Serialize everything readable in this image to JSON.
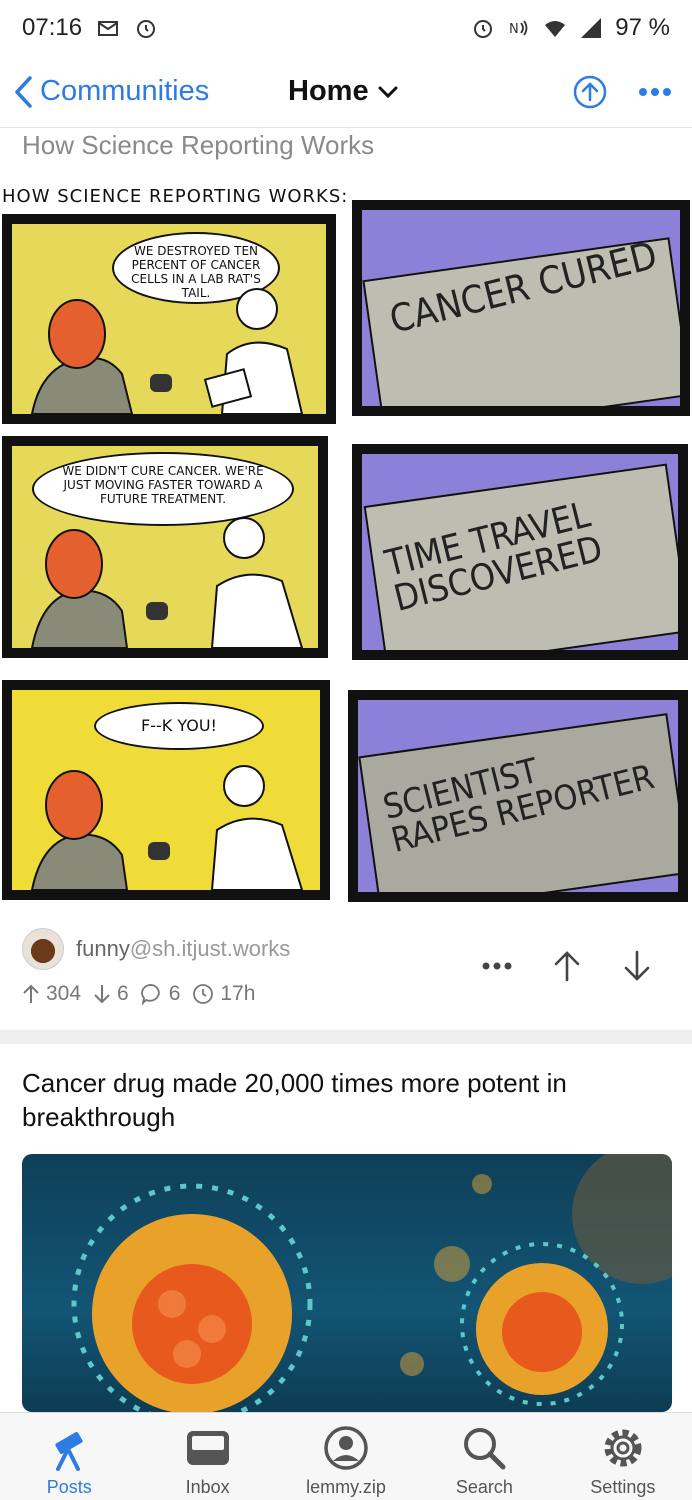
{
  "status_bar": {
    "time": "07:16",
    "battery": "97 %"
  },
  "nav": {
    "back_label": "Communities",
    "title": "Home"
  },
  "post1": {
    "title": "How Science Reporting Works",
    "comic": {
      "caption": "HOW SCIENCE REPORTING WORKS:",
      "bubble1": "WE DESTROYED TEN PERCENT OF CANCER CELLS IN A LAB RAT'S TAIL.",
      "headline1": [
        "CANCER CURED"
      ],
      "bubble2": "WE DIDN'T CURE CANCER. WE'RE JUST MOVING FASTER TOWARD A FUTURE TREATMENT.",
      "headline2": [
        "TIME TRAVEL",
        "DISCOVERED"
      ],
      "bubble3": "F--K YOU!",
      "headline3": [
        "SCIENTIST",
        "RAPES REPORTER"
      ]
    },
    "community": "funny",
    "instance": "@sh.itjust.works",
    "upvotes": "304",
    "downvotes": "6",
    "comments": "6",
    "age": "17h"
  },
  "post2": {
    "title": "Cancer drug made 20,000 times more potent in breakthrough"
  },
  "tabs": [
    {
      "label": "Posts",
      "icon": "telescope-icon"
    },
    {
      "label": "Inbox",
      "icon": "inbox-icon"
    },
    {
      "label": "lemmy.zip",
      "icon": "account-icon"
    },
    {
      "label": "Search",
      "icon": "search-icon"
    },
    {
      "label": "Settings",
      "icon": "gear-icon"
    }
  ],
  "colors": {
    "accent": "#2d7be5",
    "meta_gray": "#777777"
  }
}
